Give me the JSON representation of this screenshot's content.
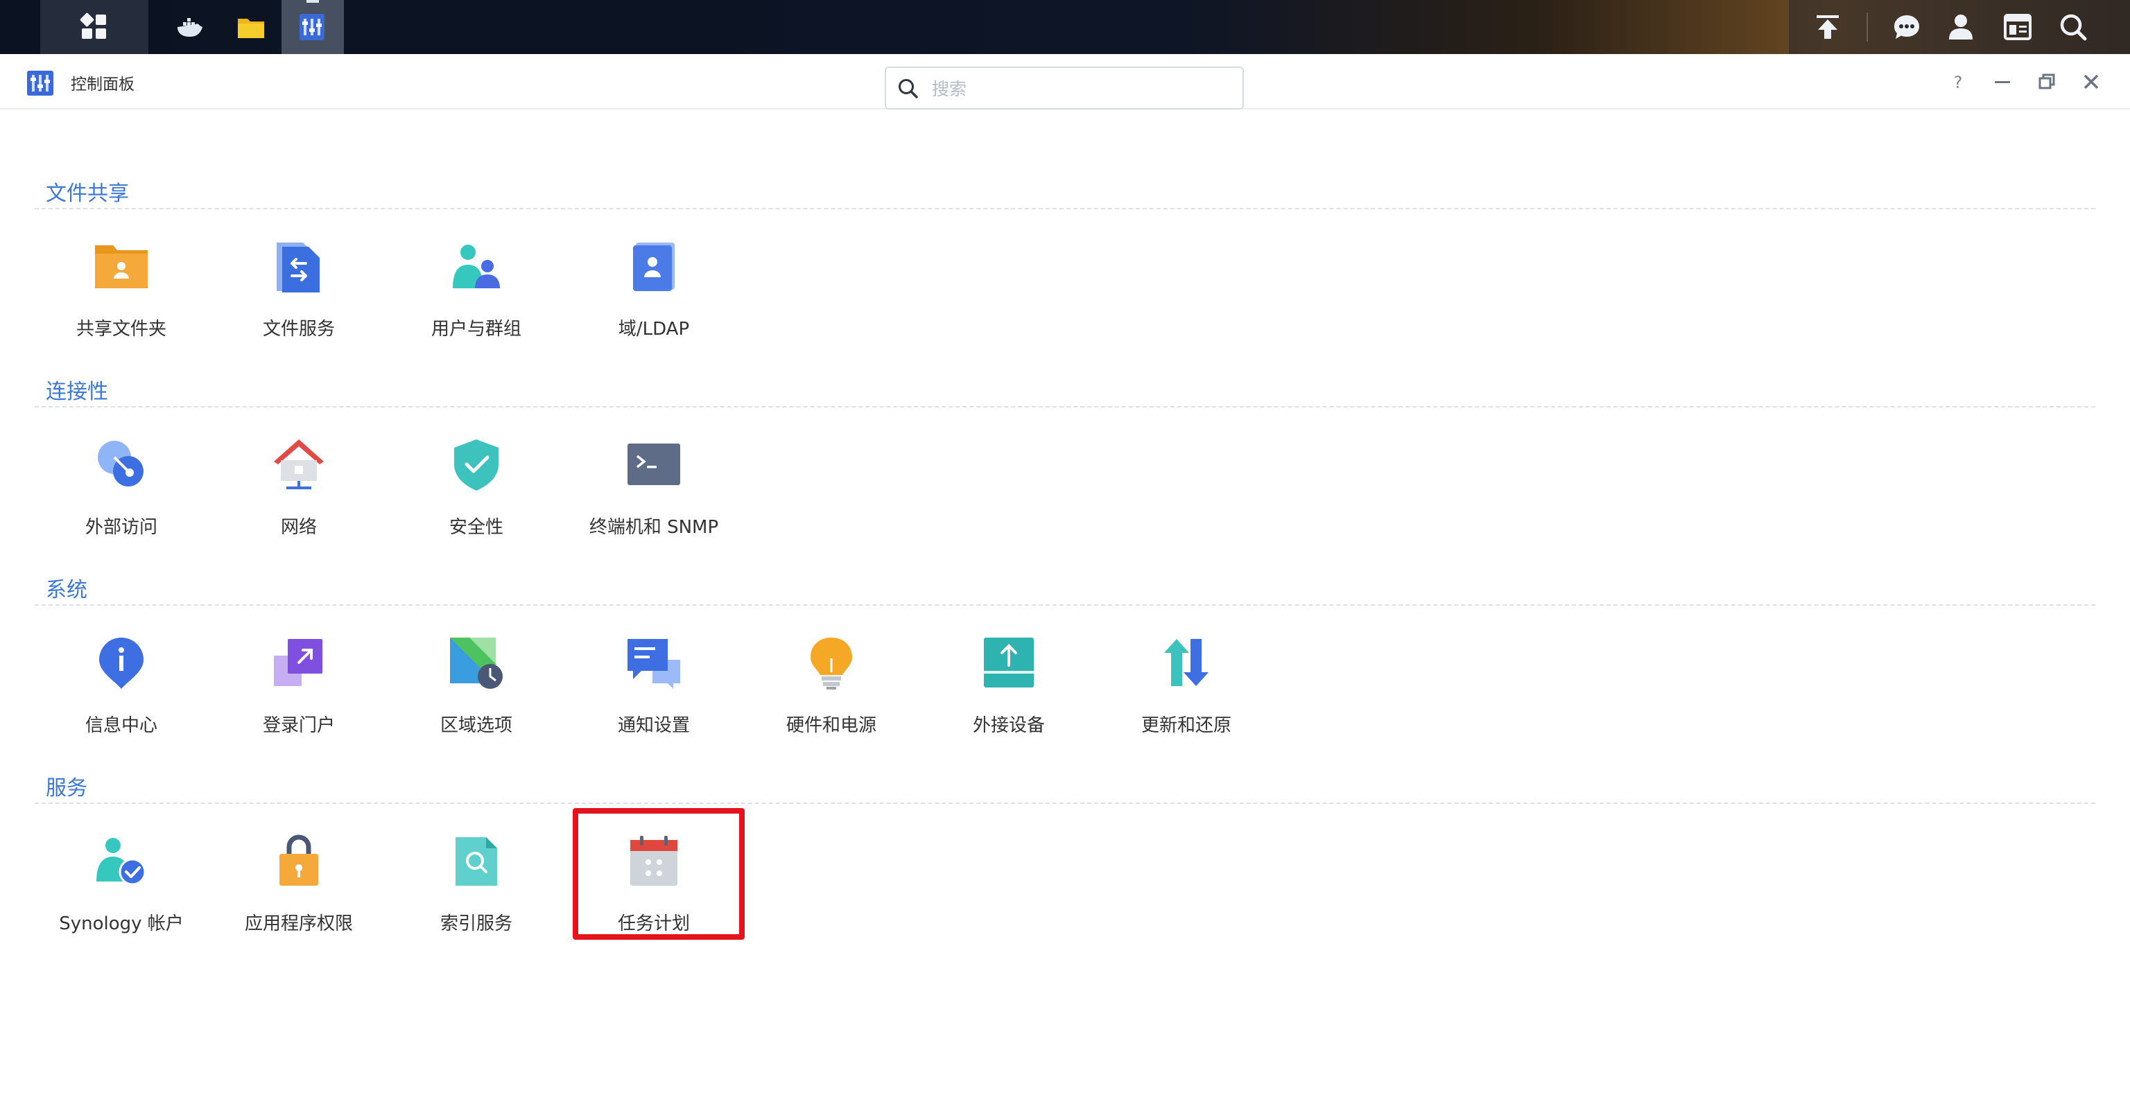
{
  "window": {
    "title": "控制面板"
  },
  "search": {
    "placeholder": "搜索"
  },
  "sections": [
    {
      "title": "文件共享",
      "items": [
        {
          "label": "共享文件夹",
          "icon": "shared-folder-icon"
        },
        {
          "label": "文件服务",
          "icon": "file-services-icon"
        },
        {
          "label": "用户与群组",
          "icon": "user-group-icon"
        },
        {
          "label": "域/LDAP",
          "icon": "domain-ldap-icon"
        }
      ]
    },
    {
      "title": "连接性",
      "items": [
        {
          "label": "外部访问",
          "icon": "external-access-icon"
        },
        {
          "label": "网络",
          "icon": "network-icon"
        },
        {
          "label": "安全性",
          "icon": "security-shield-icon"
        },
        {
          "label": "终端机和 SNMP",
          "icon": "terminal-icon"
        }
      ]
    },
    {
      "title": "系统",
      "items": [
        {
          "label": "信息中心",
          "icon": "info-center-icon"
        },
        {
          "label": "登录门户",
          "icon": "login-portal-icon"
        },
        {
          "label": "区域选项",
          "icon": "regional-options-icon"
        },
        {
          "label": "通知设置",
          "icon": "notification-icon"
        },
        {
          "label": "硬件和电源",
          "icon": "hardware-power-icon"
        },
        {
          "label": "外接设备",
          "icon": "external-devices-icon"
        },
        {
          "label": "更新和还原",
          "icon": "update-restore-icon"
        }
      ]
    },
    {
      "title": "服务",
      "items": [
        {
          "label": "Synology 帐户",
          "icon": "synology-account-icon"
        },
        {
          "label": "应用程序权限",
          "icon": "app-privileges-icon"
        },
        {
          "label": "索引服务",
          "icon": "indexing-service-icon"
        },
        {
          "label": "任务计划",
          "icon": "task-scheduler-icon"
        }
      ]
    }
  ],
  "colors": {
    "section_title": "#3d79d4",
    "highlight": "#e4141f"
  }
}
